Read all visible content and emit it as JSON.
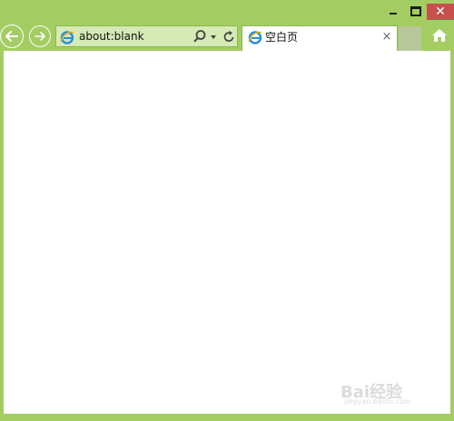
{
  "window": {
    "minimize_icon": "minimize-icon",
    "maximize_icon": "maximize-icon",
    "close_icon": "close-icon",
    "close_glyph": "✕"
  },
  "nav": {
    "back_icon": "arrow-left-icon",
    "forward_icon": "arrow-right-icon"
  },
  "address": {
    "url": "about:blank",
    "search_icon": "magnifier-icon",
    "dropdown_icon": "chevron-down-icon",
    "refresh_icon": "refresh-icon"
  },
  "tab": {
    "title": "空白页",
    "close_glyph": "×"
  },
  "toolbar": {
    "home_icon": "home-icon"
  },
  "watermark": {
    "logo_text": "Bai经验",
    "url_text": "jingyan.baidu.com"
  },
  "colors": {
    "frame": "#a3cd63",
    "address_bg": "#d5eab5",
    "close_red": "#c7504d",
    "newtab": "#b8c79b"
  }
}
